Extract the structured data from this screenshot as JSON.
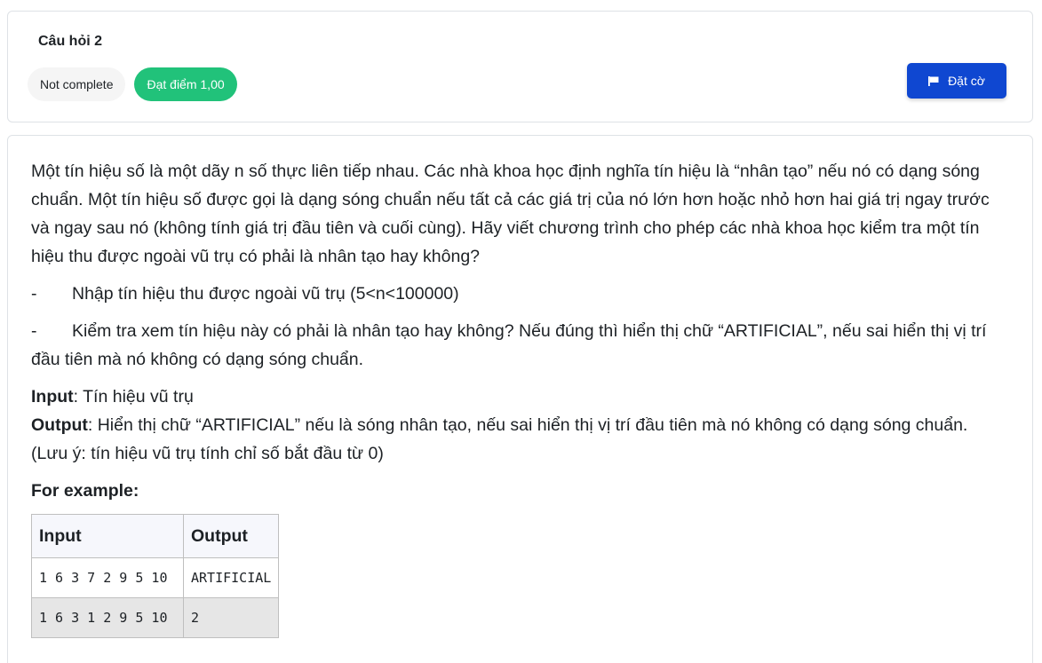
{
  "question": {
    "title": "Câu hỏi 2",
    "state_badge": "Not complete",
    "grade_badge": "Đạt điểm 1,00",
    "flag_button_label": "Đặt cờ",
    "flag_icon": "flag-icon"
  },
  "content": {
    "intro": "Một tín hiệu số là một dãy n số thực liên tiếp nhau. Các nhà khoa học định nghĩa tín hiệu là “nhân tạo” nếu nó có dạng sóng chuẩn. Một tín hiệu số được gọi là dạng sóng chuẩn nếu tất cả các giá trị của nó lớn hơn hoặc nhỏ hơn hai giá trị ngay trước và ngay sau nó (không tính giá trị đầu tiên và cuối cùng). Hãy viết chương trình cho phép các nhà khoa học kiểm tra một tín hiệu thu được ngoài vũ trụ có phải là nhân tạo hay không?",
    "bullets": [
      {
        "dash": "-",
        "text": "Nhập tín hiệu thu được ngoài vũ trụ (5<n<100000)"
      },
      {
        "dash": "-",
        "text": "Kiểm tra xem tín hiệu này có phải là nhân tạo hay không? Nếu đúng thì hiển thị chữ “ARTIFICIAL”, nếu sai hiển thị vị trí đầu tiên mà nó không có dạng sóng chuẩn."
      }
    ],
    "input_label": "Input",
    "input_text": ": Tín hiệu vũ trụ",
    "output_label": "Output",
    "output_text": ": Hiển thị chữ “ARTIFICIAL” nếu là sóng nhân tạo, nếu sai hiển thị vị trí đầu tiên mà nó không có dạng sóng chuẩn.",
    "note": "(Lưu ý: tín hiệu vũ trụ tính chỉ số bắt đầu từ 0)",
    "example_heading": "For example:",
    "table": {
      "headers": [
        "Input",
        "Output"
      ],
      "rows": [
        [
          "1 6 3 7 2 9 5 10",
          "ARTIFICIAL"
        ],
        [
          "1 6 3 1 2 9 5 10",
          "2"
        ]
      ]
    }
  }
}
